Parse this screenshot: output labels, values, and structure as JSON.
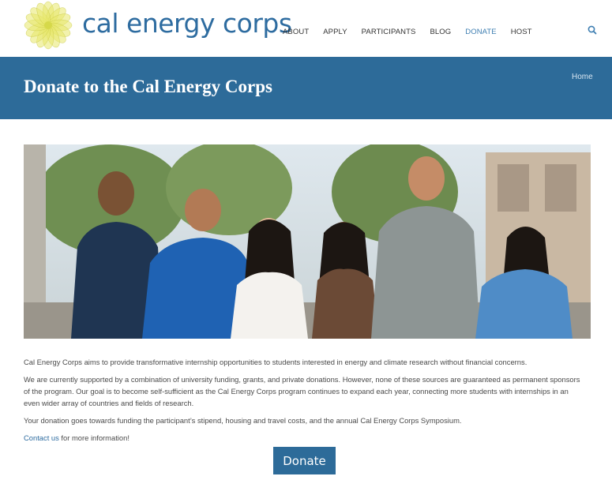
{
  "header": {
    "brand": "cal energy corps",
    "nav": [
      {
        "label": "ABOUT"
      },
      {
        "label": "APPLY"
      },
      {
        "label": "PARTICIPANTS"
      },
      {
        "label": "BLOG"
      },
      {
        "label": "DONATE",
        "active": true
      },
      {
        "label": "HOST"
      }
    ],
    "search_icon": "magnifier-icon"
  },
  "banner": {
    "title": "Donate to the Cal Energy Corps",
    "breadcrumb": "Home"
  },
  "content": {
    "p1": "Cal Energy Corps aims to provide transformative internship opportunities to students interested in energy and climate research without financial concerns.",
    "p2": "We are currently supported by a combination of university funding, grants, and private donations. However, none of these sources are guaranteed as permanent sponsors of the program. Our goal is to become self-sufficient as the Cal Energy Corps program continues to expand each year, connecting more students with internships in an even wider array of countries and fields of research.",
    "p3": "Your donation goes towards funding the participant’s stipend, housing and travel costs, and the annual Cal Energy Corps Symposium.",
    "contact_link": "Contact us",
    "contact_rest": " for more information!"
  },
  "donate_button": "Donate",
  "colors": {
    "brand_blue": "#2e6ca0",
    "banner_blue": "#2d6b99",
    "logo_yellow": "#e8e86a"
  }
}
